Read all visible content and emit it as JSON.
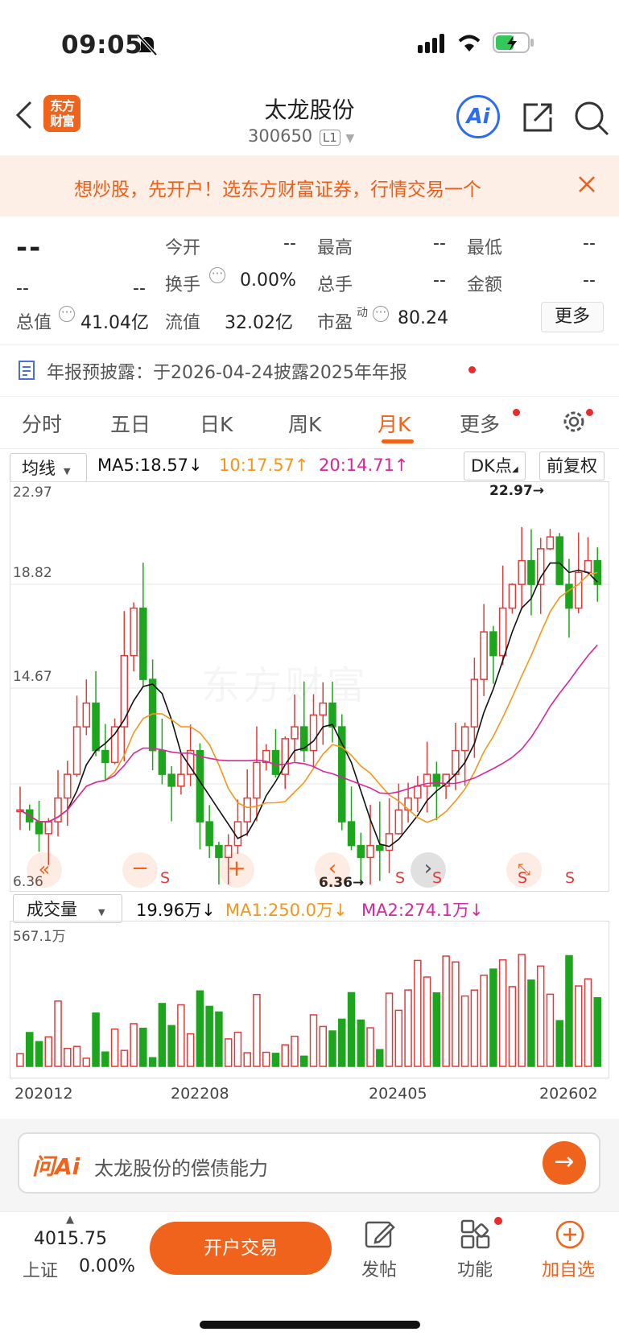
{
  "status": {
    "time": "09:05"
  },
  "header": {
    "title": "太龙股份",
    "code": "300650",
    "level": "L1",
    "brand": "东方财富",
    "ai_label": "Ai"
  },
  "banner": {
    "text": "想炒股，先开户！选东方财富证券，行情交易一个"
  },
  "quote": {
    "price": "--",
    "change": "--",
    "change_pct": "--",
    "open_label": "今开",
    "open": "--",
    "high_label": "最高",
    "high": "--",
    "low_label": "最低",
    "low": "--",
    "turnover_label": "换手",
    "turnover": "0.00%",
    "volume_label": "总手",
    "volume": "--",
    "amount_label": "金额",
    "amount": "--",
    "mktcap_label": "总值",
    "mktcap": "41.04亿",
    "float_label": "流值",
    "float": "32.02亿",
    "pe_label": "市盈",
    "pe_sup": "动",
    "pe": "80.24",
    "more_btn": "更多"
  },
  "notice": {
    "text": "年报预披露：于2026-04-24披露2025年年报"
  },
  "tabs": [
    "分时",
    "五日",
    "日K",
    "周K",
    "月K",
    "更多"
  ],
  "active_tab": "月K",
  "ma_bar": {
    "select": "均线",
    "ma5": "MA5:18.57↓",
    "ma10": "10:17.57↑",
    "ma20": "20:14.71↑",
    "dk": "DK点",
    "fq": "前复权"
  },
  "chart_data": {
    "type": "candlestick",
    "price_ticks": [
      "22.97",
      "18.82",
      "14.67",
      "6.36"
    ],
    "ylim": [
      6.36,
      22.97
    ],
    "max_marker": "22.97→",
    "min_marker": "6.36→",
    "x_labels": [
      "202012",
      "202208",
      "202405",
      "202602"
    ],
    "watermark": "东方财富",
    "signal_labels": [
      "S",
      "S",
      "S",
      "S",
      "S"
    ],
    "colors": {
      "up": "#e03b3b",
      "down": "#1ea51e",
      "ma5": "#111111",
      "ma10": "#f5961c",
      "ma20": "#d8279c"
    }
  },
  "vol_bar": {
    "select": "成交量",
    "vol": "19.96万↓",
    "ma1": "MA1:250.0万↓",
    "ma2": "MA2:274.1万↓",
    "max": "567.1万"
  },
  "ai_input": {
    "brand": "问Ai",
    "placeholder": "太龙股份的偿债能力"
  },
  "bottom": {
    "index_value": "4015.75",
    "index_name": "上证",
    "index_change": "0.00%",
    "open_btn": "开户交易",
    "post": "发帖",
    "func": "功能",
    "add": "加自选"
  }
}
